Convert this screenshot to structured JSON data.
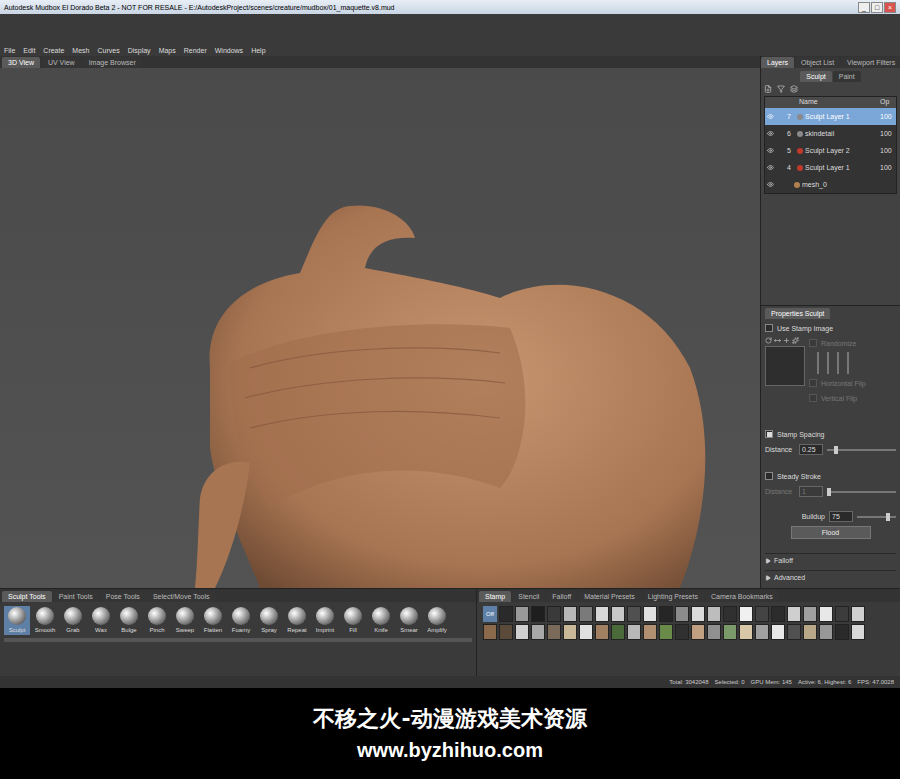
{
  "window": {
    "title": "Autodesk Mudbox El Dorado Beta 2 - NOT FOR RESALE - E:/AutodeskProject/scenes/creature/mudbox/01_maquette.v8.mud",
    "controls": [
      "_",
      "□",
      "×"
    ]
  },
  "menu": [
    "File",
    "Edit",
    "Create",
    "Mesh",
    "Curves",
    "Display",
    "Maps",
    "Render",
    "Windows",
    "Help"
  ],
  "view_tabs": [
    {
      "label": "3D View",
      "selected": true
    },
    {
      "label": "UV View",
      "selected": false
    },
    {
      "label": "Image Browser",
      "selected": false
    }
  ],
  "panel_tabs": [
    {
      "label": "Layers",
      "selected": true
    },
    {
      "label": "Object List",
      "selected": false
    },
    {
      "label": "Viewport Filters",
      "selected": false
    }
  ],
  "layer_tabs": [
    {
      "label": "Sculpt",
      "selected": true
    },
    {
      "label": "Paint",
      "selected": false
    }
  ],
  "layers": {
    "columns": [
      "Name",
      "Op"
    ],
    "rows": [
      {
        "name": "Sculpt Layer 1",
        "index": "7",
        "opacity": "100",
        "selected": true,
        "kind": "layer",
        "color": "#8a8a8a"
      },
      {
        "name": "skindetail",
        "index": "6",
        "opacity": "100",
        "selected": false,
        "kind": "layer",
        "color": "#8a8a8a"
      },
      {
        "name": "Sculpt Layer 2",
        "index": "5",
        "opacity": "100",
        "selected": false,
        "kind": "layer",
        "color": "#c0392b"
      },
      {
        "name": "Sculpt Layer 1",
        "index": "4",
        "opacity": "100",
        "selected": false,
        "kind": "layer",
        "color": "#c0392b"
      },
      {
        "name": "mesh_0",
        "index": "",
        "opacity": "",
        "selected": false,
        "kind": "mesh",
        "color": "#b08050"
      }
    ]
  },
  "properties": {
    "title": "Properties Sculpt",
    "use_stamp_image": {
      "label": "Use Stamp Image",
      "checked": false
    },
    "randomize": {
      "label": "Randomize",
      "checked": false,
      "disabled": true
    },
    "horizontal_flip": {
      "label": "Horizontal Flip",
      "checked": false,
      "disabled": true
    },
    "vertical_flip": {
      "label": "Vertical Flip",
      "checked": false,
      "disabled": true
    },
    "stamp_spacing": {
      "label": "Stamp Spacing",
      "checked": true
    },
    "spacing_distance": {
      "label": "Distance",
      "value": "0.25",
      "level": 0.1,
      "disabled": false
    },
    "steady_stroke": {
      "label": "Steady Stroke",
      "checked": false
    },
    "steady_distance": {
      "label": "Distance",
      "value": "1",
      "level": 0.0,
      "disabled": true
    },
    "buildup": {
      "label": "Buildup",
      "value": "75",
      "level": 0.75
    },
    "flood": "Flood",
    "sections": [
      {
        "label": "Falloff",
        "expanded": false
      },
      {
        "label": "Advanced",
        "expanded": false
      }
    ]
  },
  "tool_tabs": [
    {
      "label": "Sculpt Tools",
      "selected": true
    },
    {
      "label": "Paint Tools",
      "selected": false
    },
    {
      "label": "Pose Tools",
      "selected": false
    },
    {
      "label": "Select/Move Tools",
      "selected": false
    }
  ],
  "tools": [
    {
      "name": "Sculpt",
      "selected": true
    },
    {
      "name": "Smooth",
      "selected": false
    },
    {
      "name": "Grab",
      "selected": false
    },
    {
      "name": "Wax",
      "selected": false
    },
    {
      "name": "Bulge",
      "selected": false
    },
    {
      "name": "Pinch",
      "selected": false
    },
    {
      "name": "Sweep",
      "selected": false
    },
    {
      "name": "Flatten",
      "selected": false
    },
    {
      "name": "Foamy",
      "selected": false
    },
    {
      "name": "Spray",
      "selected": false
    },
    {
      "name": "Repeat",
      "selected": false
    },
    {
      "name": "Imprint",
      "selected": false
    },
    {
      "name": "Fill",
      "selected": false
    },
    {
      "name": "Knife",
      "selected": false
    },
    {
      "name": "Smear",
      "selected": false
    },
    {
      "name": "Amplify",
      "selected": false
    }
  ],
  "tray_tabs": [
    {
      "label": "Stamp",
      "selected": true
    },
    {
      "label": "Stencil",
      "selected": false
    },
    {
      "label": "Falloff",
      "selected": false
    },
    {
      "label": "Material Presets",
      "selected": false
    },
    {
      "label": "Lighting Presets",
      "selected": false
    },
    {
      "label": "Camera Bookmarks",
      "selected": false
    }
  ],
  "stamps": {
    "off_label": "Off",
    "off_selected": true,
    "tiles": [
      "#2a2a2a",
      "#9a9a9a",
      "#1e1e1e",
      "#3a3a3a",
      "#b8b8b8",
      "#7a7a7a",
      "#d8d8d8",
      "#c8c8c8",
      "#505050",
      "#e0e0e0",
      "#262626",
      "#8c8c8c",
      "#dcdcdc",
      "#bdbdbd",
      "#303030",
      "#f0f0f0",
      "#444444",
      "#2c2c2c",
      "#cfcfcf",
      "#a0a0a0",
      "#e8e8e8",
      "#3c3c3c",
      "#d0d0d0",
      "#8a6a4a",
      "#5a4a3a",
      "#d0d0d0",
      "#a8a8a8",
      "#7a6a5a",
      "#c8b898",
      "#e0e0e0",
      "#a08060",
      "#4a6a3a",
      "#b8b8b8",
      "#b09070",
      "#6a8a4a",
      "#303030",
      "#c0a080",
      "#909090",
      "#7a9a6a",
      "#d8c8a8",
      "#a0a0a0",
      "#e8e8e8",
      "#505050",
      "#b8a888",
      "#989898",
      "#2a2a2a",
      "#d8d8d8"
    ]
  },
  "status": [
    "Total: 3042048",
    "Selected: 0",
    "GPU Mem: 145",
    "Active: 6, Highest: 6",
    "FPS: 47.0028"
  ],
  "watermark": {
    "line1": "不移之火-动漫游戏美术资源",
    "line2": "www.byzhihuo.com"
  }
}
